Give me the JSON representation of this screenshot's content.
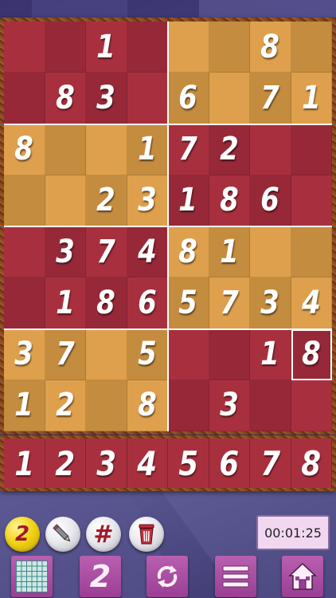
{
  "board": {
    "rows": [
      [
        "",
        "",
        "1",
        "",
        "",
        "",
        "8",
        ""
      ],
      [
        "",
        "8",
        "3",
        "",
        "6",
        "",
        "7",
        "1"
      ],
      [
        "8",
        "",
        "",
        "1",
        "7",
        "2",
        "",
        ""
      ],
      [
        "",
        "",
        "2",
        "3",
        "1",
        "8",
        "6",
        ""
      ],
      [
        "",
        "3",
        "7",
        "4",
        "8",
        "1",
        "",
        ""
      ],
      [
        "",
        "1",
        "8",
        "6",
        "5",
        "7",
        "3",
        "4"
      ],
      [
        "3",
        "7",
        "",
        "5",
        "",
        "",
        "1",
        "8"
      ],
      [
        "1",
        "2",
        "",
        "8",
        "",
        "3",
        "",
        ""
      ]
    ],
    "selected": {
      "row": 6,
      "col": 7
    },
    "colors": {
      "red": "#a8303e",
      "red_dark": "#962838",
      "gold": "#dea04c",
      "gold_dark": "#c48c3e",
      "box_line": "#ffffff"
    }
  },
  "keypad": {
    "keys": [
      "1",
      "2",
      "3",
      "4",
      "5",
      "6",
      "7",
      "8"
    ]
  },
  "tools": {
    "hints_remaining": "2",
    "hint_icon": "hint-coin-icon",
    "pencil_icon": "pencil-icon",
    "number_grid_icon": "hash-icon",
    "trash_icon": "trash-can-icon",
    "hash_glyph": "#"
  },
  "timer": {
    "elapsed": "00:01:25"
  },
  "bottom_bar": {
    "grid_icon": "grid-icon",
    "number_mode_label": "2",
    "refresh_icon": "refresh-icon",
    "menu_icon": "menu-icon",
    "home_icon": "home-icon"
  }
}
